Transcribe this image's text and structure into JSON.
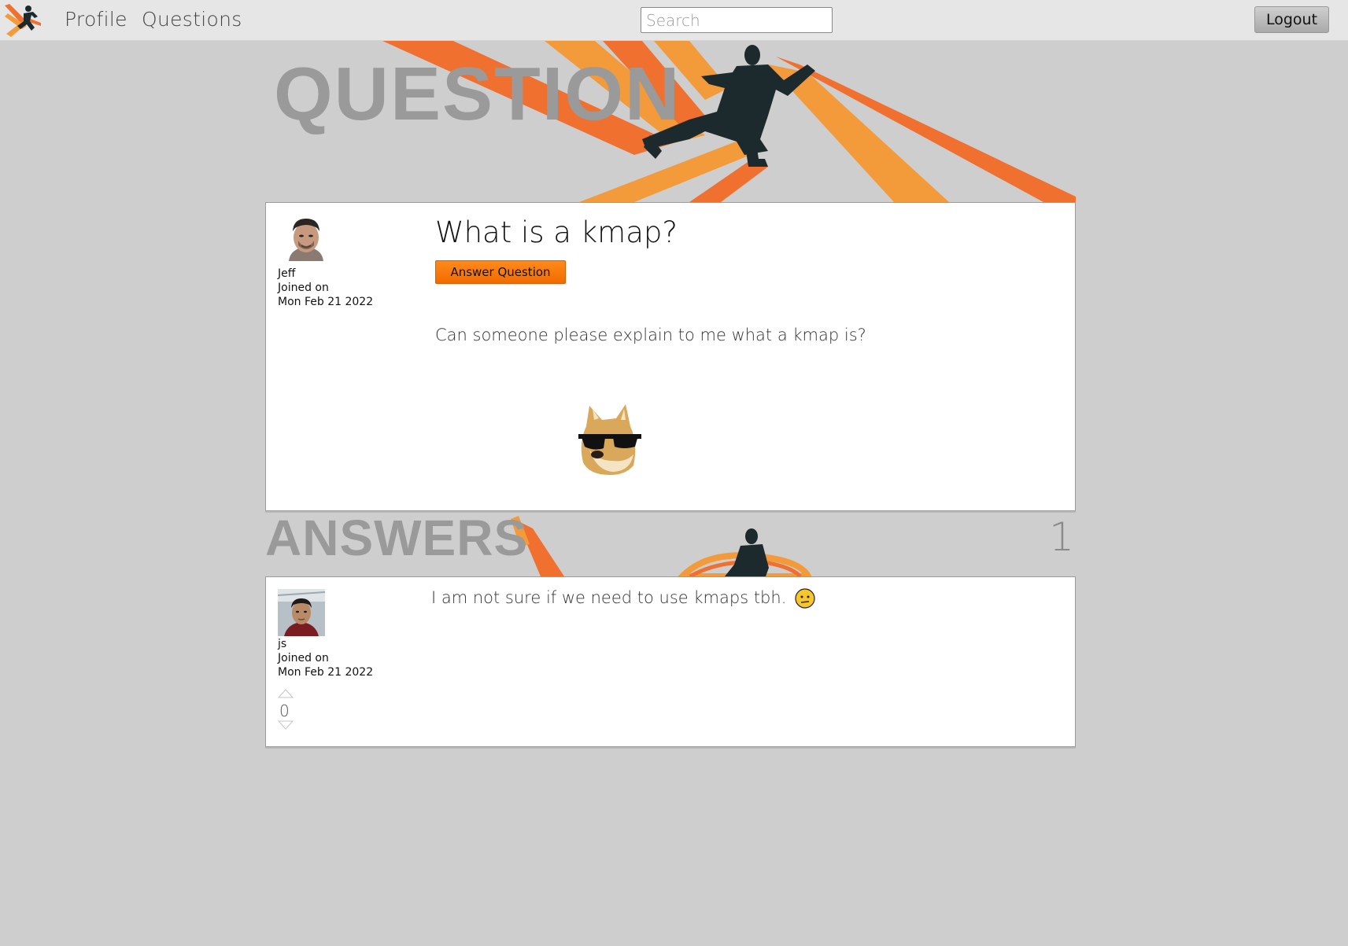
{
  "nav": {
    "profile_label": "Profile",
    "questions_label": "Questions",
    "search_placeholder": "Search",
    "logout_label": "Logout"
  },
  "hero": {
    "title": "QUESTION"
  },
  "question": {
    "author": "Jeff",
    "joined_label": "Joined on",
    "joined_date": "Mon Feb 21 2022",
    "title": "What is a kmap?",
    "answer_button_label": "Answer Question",
    "body": "Can someone please explain to me what a kmap is?"
  },
  "answers_section": {
    "title": "ANSWERS",
    "count": "1"
  },
  "answers": [
    {
      "author": "js",
      "joined_label": "Joined on",
      "joined_date": "Mon Feb 21 2022",
      "body": "I am not sure if we need to use kmaps tbh.",
      "votes": "0"
    }
  ],
  "colors": {
    "accent_orange": "#f26b00",
    "stripe_orange_dark": "#f07030",
    "stripe_orange_light": "#f39a3a",
    "silhouette": "#1c2a2e",
    "page_bg": "#cecece",
    "title_grey": "#9a9a9a"
  }
}
